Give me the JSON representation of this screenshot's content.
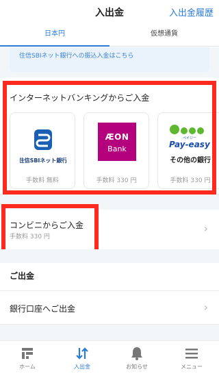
{
  "header": {
    "title": "入出金",
    "history_link": "入出金履歴"
  },
  "tabs": [
    {
      "label": "日本円",
      "active": true
    },
    {
      "label": "仮想通貨",
      "active": false
    }
  ],
  "notice": {
    "text": "住信SBIネット銀行への振込入金はこちら"
  },
  "internet_banking": {
    "heading": "インターネットバンキングからご入金",
    "banks": [
      {
        "name": "住信SBIネット銀行",
        "logo_text": "住信SBIネット銀行",
        "fee": "手数料 無料"
      },
      {
        "name": "AEON Bank",
        "logo_line1": "ÆON",
        "logo_line2": "Bank",
        "fee": "手数料 330 円"
      },
      {
        "name": "Pay-easy",
        "logo_small": "ペイジー",
        "logo_main": "Pay-easy",
        "caption": "その他の銀行",
        "fee": "手数料 330 円"
      }
    ]
  },
  "convenience": {
    "title": "コンビニからご入金",
    "fee": "手数料 330 円"
  },
  "withdrawal": {
    "heading": "ご出金",
    "bank_account": "銀行口座へご出金"
  },
  "tabbar": [
    {
      "label": "ホーム",
      "icon": "home-icon",
      "active": false
    },
    {
      "label": "入出金",
      "icon": "transfer-icon",
      "active": true
    },
    {
      "label": "お知らせ",
      "icon": "bell-icon",
      "active": false
    },
    {
      "label": "メニュー",
      "icon": "menu-icon",
      "active": false
    }
  ],
  "colors": {
    "accent": "#2a7ad8",
    "highlight": "#ff2a1f",
    "aeon": "#b5007e"
  }
}
